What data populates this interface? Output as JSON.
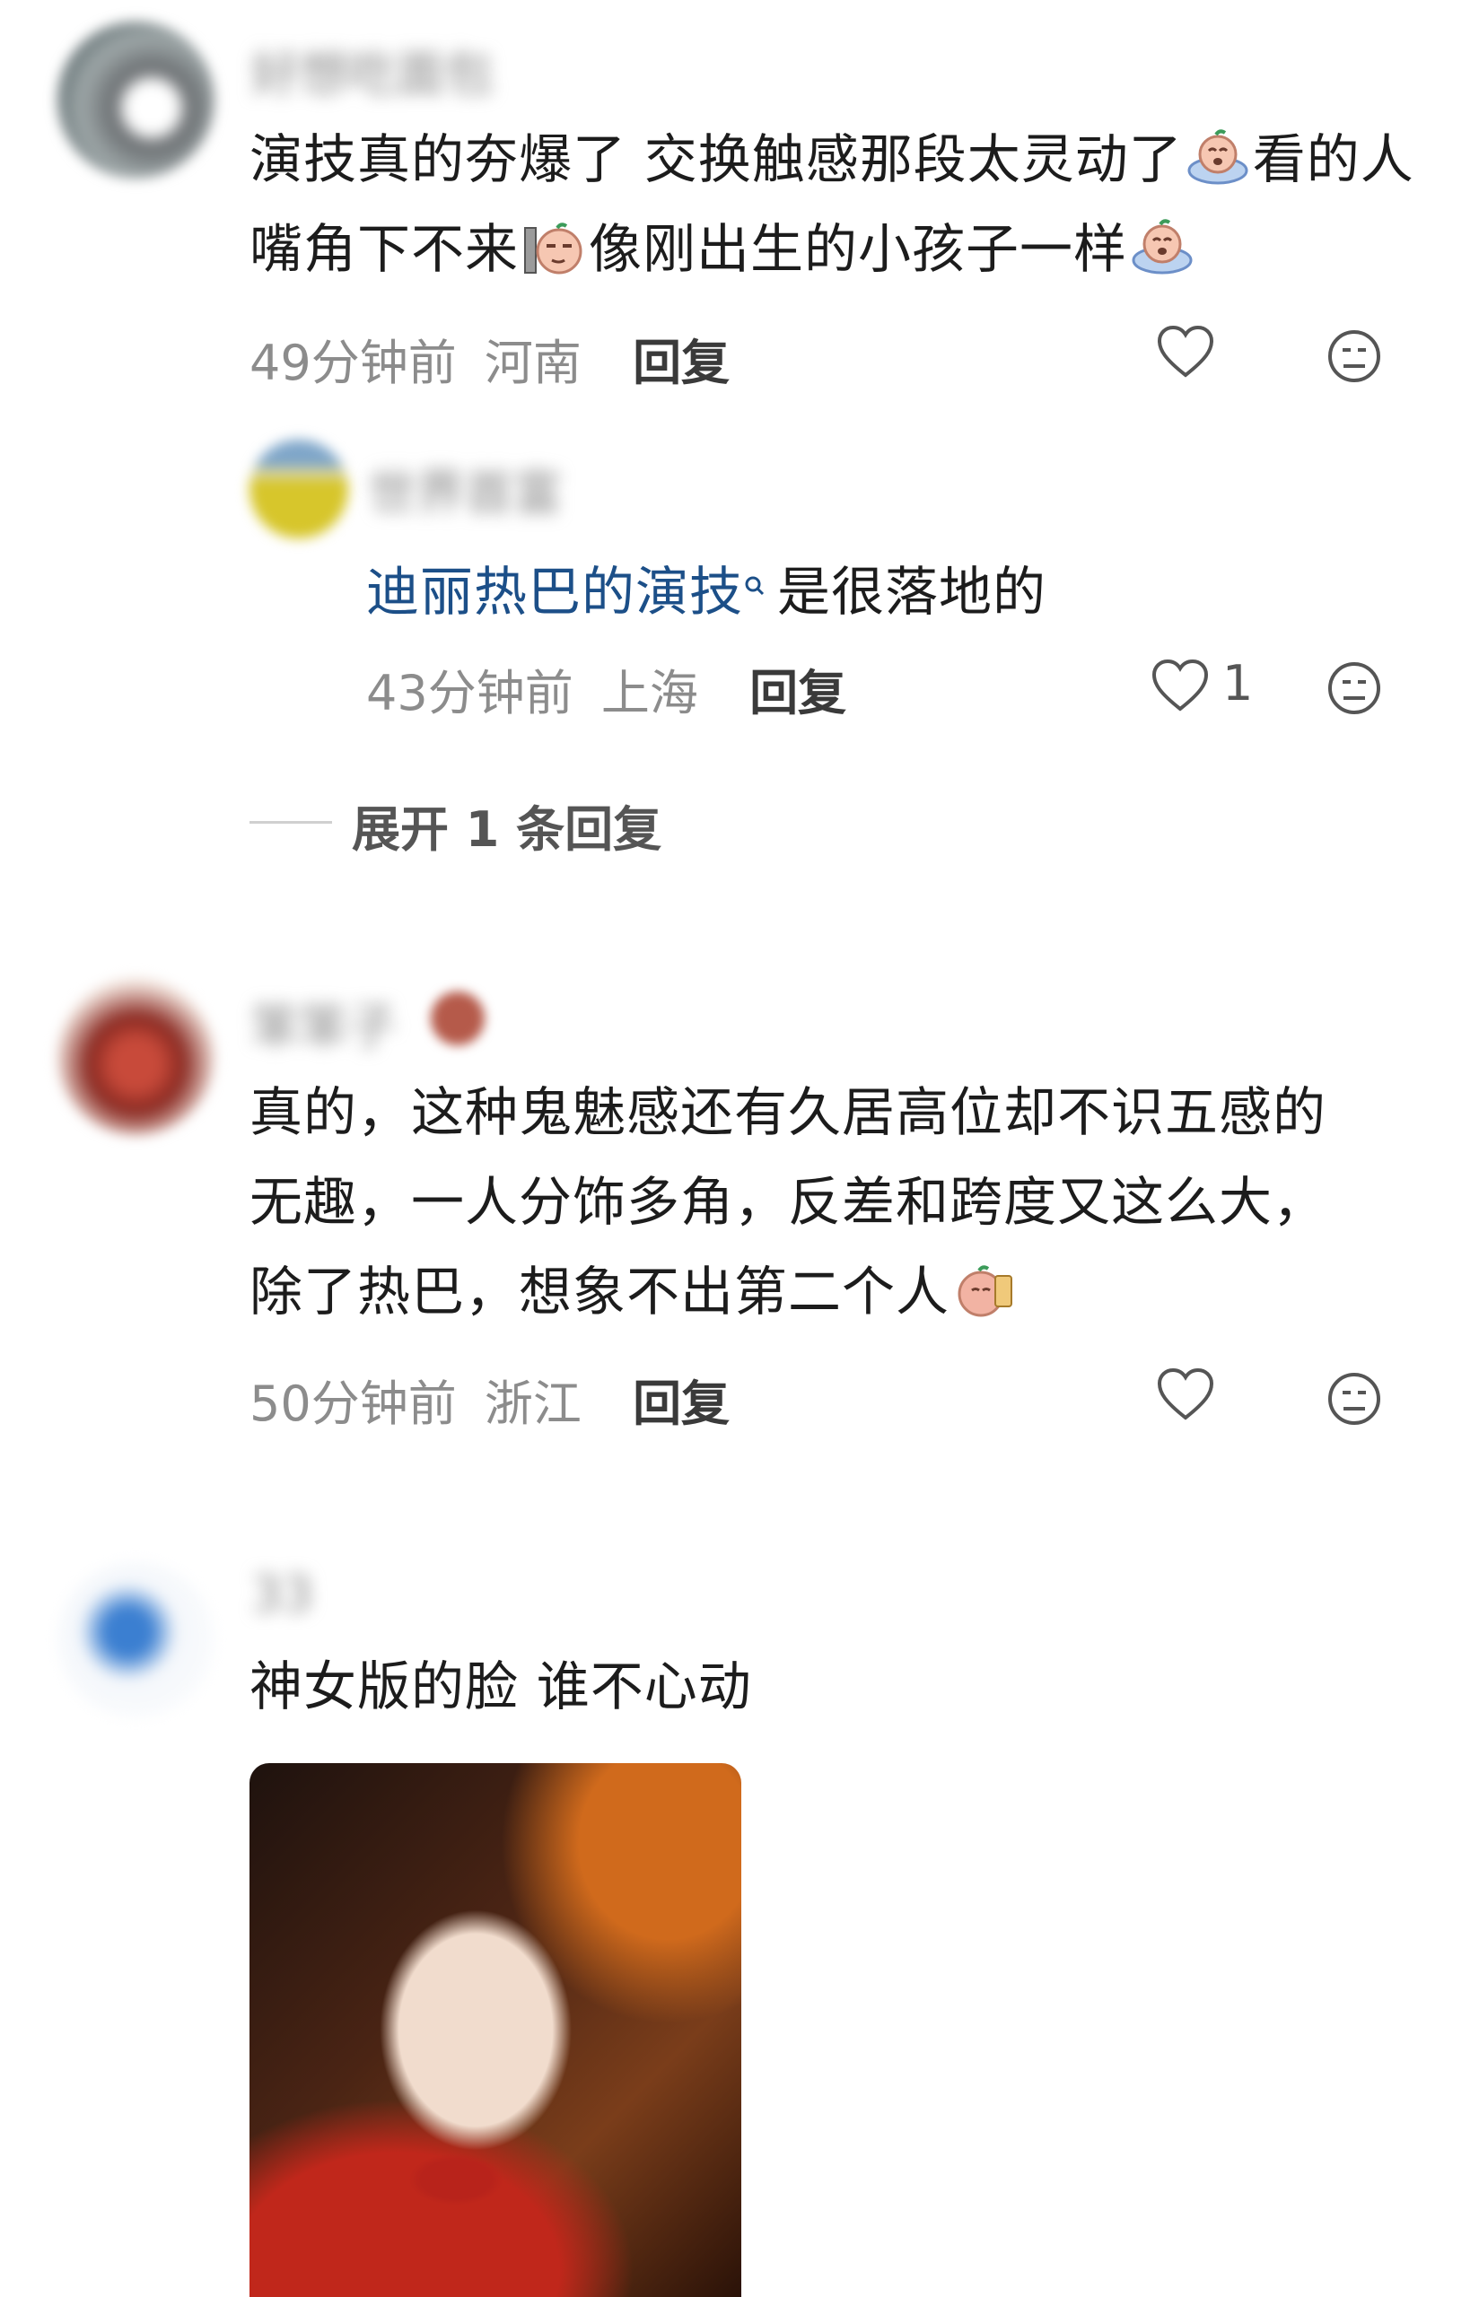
{
  "comments": [
    {
      "username": "好想吃面包",
      "text_parts": [
        "演技真的夯爆了 交换触感那段太灵动了",
        "看的人嘴角下不来",
        "像刚出生的小孩子一样"
      ],
      "emoji": [
        "crying-emoji",
        "sideeye-emoji",
        "crying-emoji"
      ],
      "time": "49分钟前",
      "location": "河南",
      "reply_label": "回复",
      "likes": ""
    },
    {
      "username": "世界首富",
      "link_text": "迪丽热巴的演技",
      "link_icon": "search-icon",
      "text_after": "是很落地的",
      "time": "43分钟前",
      "location": "上海",
      "reply_label": "回复",
      "likes": "1"
    },
    {
      "username": "笨笨子",
      "lines": [
        "真的，这种鬼魅感还有久居高位却不识五感的",
        "无趣，一人分饰多角，反差和跨度又这么大，",
        "除了热巴，想象不出第二个人"
      ],
      "emoji": [
        "snack-emoji"
      ],
      "time": "50分钟前",
      "location": "浙江",
      "reply_label": "回复",
      "likes": ""
    },
    {
      "username": "33",
      "text": "神女版的脸 谁不心动",
      "image_alt": "portrait-image"
    }
  ],
  "expand": {
    "label": "展开 1 条回复"
  },
  "colors": {
    "link": "#1c4f88",
    "meta": "#8c8c8c",
    "icon": "#555555"
  }
}
